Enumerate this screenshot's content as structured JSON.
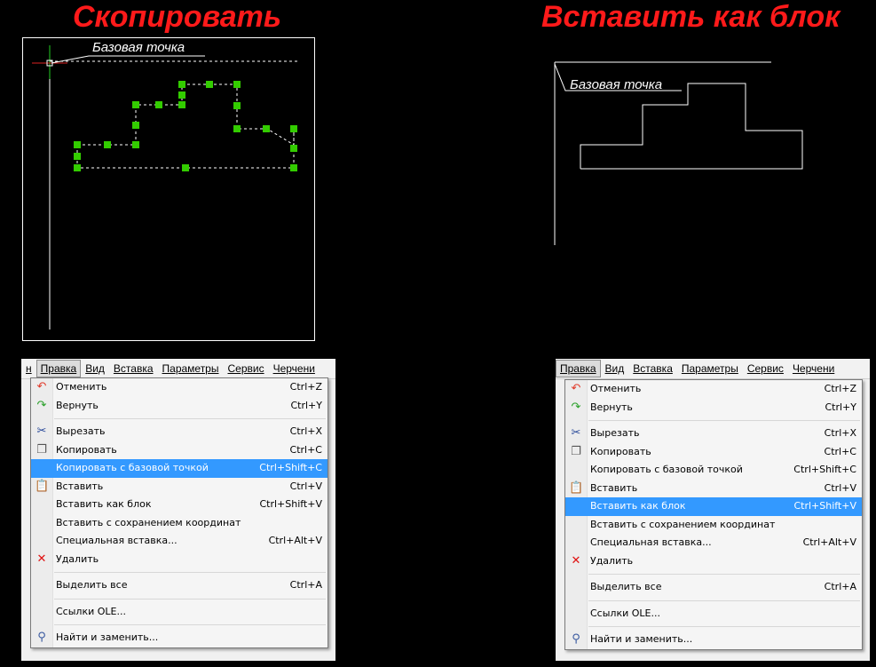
{
  "titles": {
    "copy": "Скопировать",
    "paste_block": "Вставить как блок"
  },
  "annotation": {
    "base_point": "Базовая точка"
  },
  "colors": {
    "title": "#ff1a1a",
    "grip": "#33cc00",
    "highlight": "#3399ff"
  },
  "menubar": {
    "left": [
      "н",
      "Правка",
      "Вид",
      "Вставка",
      "Параметры",
      "Сервис",
      "Черчени"
    ],
    "right": [
      "Правка",
      "Вид",
      "Вставка",
      "Параметры",
      "Сервис",
      "Черчени"
    ]
  },
  "menu_left": {
    "highlighted": "Копировать с базовой точкой",
    "items": [
      {
        "icon": "undo-icon",
        "glyph": "↶",
        "color": "#e03a2a",
        "label": "Отменить",
        "shortcut": "Ctrl+Z"
      },
      {
        "icon": "redo-icon",
        "glyph": "↷",
        "color": "#2aa02a",
        "label": "Вернуть",
        "shortcut": "Ctrl+Y"
      },
      {
        "sep": true
      },
      {
        "icon": "cut-icon",
        "glyph": "✂",
        "color": "#2a4a9a",
        "label": "Вырезать",
        "shortcut": "Ctrl+X"
      },
      {
        "icon": "copy-icon",
        "glyph": "❐",
        "color": "#555555",
        "label": "Копировать",
        "shortcut": "Ctrl+C"
      },
      {
        "icon": "",
        "glyph": "",
        "color": "",
        "label": "Копировать с базовой точкой",
        "shortcut": "Ctrl+Shift+C"
      },
      {
        "icon": "paste-icon",
        "glyph": "📋",
        "color": "#b08020",
        "label": "Вставить",
        "shortcut": "Ctrl+V"
      },
      {
        "icon": "",
        "glyph": "",
        "color": "",
        "label": "Вставить как блок",
        "shortcut": "Ctrl+Shift+V"
      },
      {
        "icon": "",
        "glyph": "",
        "color": "",
        "label": "Вставить с сохранением координат",
        "shortcut": ""
      },
      {
        "icon": "",
        "glyph": "",
        "color": "",
        "label": "Специальная вставка...",
        "shortcut": "Ctrl+Alt+V"
      },
      {
        "icon": "delete-icon",
        "glyph": "✕",
        "color": "#e01010",
        "label": "Удалить",
        "shortcut": ""
      },
      {
        "sep": true
      },
      {
        "icon": "",
        "glyph": "",
        "color": "",
        "label": "Выделить все",
        "shortcut": "Ctrl+A"
      },
      {
        "sep": true
      },
      {
        "icon": "",
        "glyph": "",
        "color": "",
        "label": "Ссылки OLE...",
        "shortcut": ""
      },
      {
        "sep": true
      },
      {
        "icon": "find-icon",
        "glyph": "⚲",
        "color": "#3a5aa0",
        "label": "Найти и заменить...",
        "shortcut": ""
      }
    ]
  },
  "menu_right": {
    "highlighted": "Вставить как блок",
    "items": [
      {
        "icon": "undo-icon",
        "glyph": "↶",
        "color": "#e03a2a",
        "label": "Отменить",
        "shortcut": "Ctrl+Z"
      },
      {
        "icon": "redo-icon",
        "glyph": "↷",
        "color": "#2aa02a",
        "label": "Вернуть",
        "shortcut": "Ctrl+Y"
      },
      {
        "sep": true
      },
      {
        "icon": "cut-icon",
        "glyph": "✂",
        "color": "#2a4a9a",
        "label": "Вырезать",
        "shortcut": "Ctrl+X"
      },
      {
        "icon": "copy-icon",
        "glyph": "❐",
        "color": "#555555",
        "label": "Копировать",
        "shortcut": "Ctrl+C"
      },
      {
        "icon": "",
        "glyph": "",
        "color": "",
        "label": "Копировать с базовой точкой",
        "shortcut": "Ctrl+Shift+C"
      },
      {
        "icon": "paste-icon",
        "glyph": "📋",
        "color": "#b08020",
        "label": "Вставить",
        "shortcut": "Ctrl+V"
      },
      {
        "icon": "",
        "glyph": "",
        "color": "",
        "label": "Вставить как блок",
        "shortcut": "Ctrl+Shift+V"
      },
      {
        "icon": "",
        "glyph": "",
        "color": "",
        "label": "Вставить с сохранением координат",
        "shortcut": ""
      },
      {
        "icon": "",
        "glyph": "",
        "color": "",
        "label": "Специальная вставка...",
        "shortcut": "Ctrl+Alt+V"
      },
      {
        "icon": "delete-icon",
        "glyph": "✕",
        "color": "#e01010",
        "label": "Удалить",
        "shortcut": ""
      },
      {
        "sep": true
      },
      {
        "icon": "",
        "glyph": "",
        "color": "",
        "label": "Выделить все",
        "shortcut": "Ctrl+A"
      },
      {
        "sep": true
      },
      {
        "icon": "",
        "glyph": "",
        "color": "",
        "label": "Ссылки OLE...",
        "shortcut": ""
      },
      {
        "sep": true
      },
      {
        "icon": "find-icon",
        "glyph": "⚲",
        "color": "#3a5aa0",
        "label": "Найти и заменить...",
        "shortcut": ""
      }
    ]
  }
}
